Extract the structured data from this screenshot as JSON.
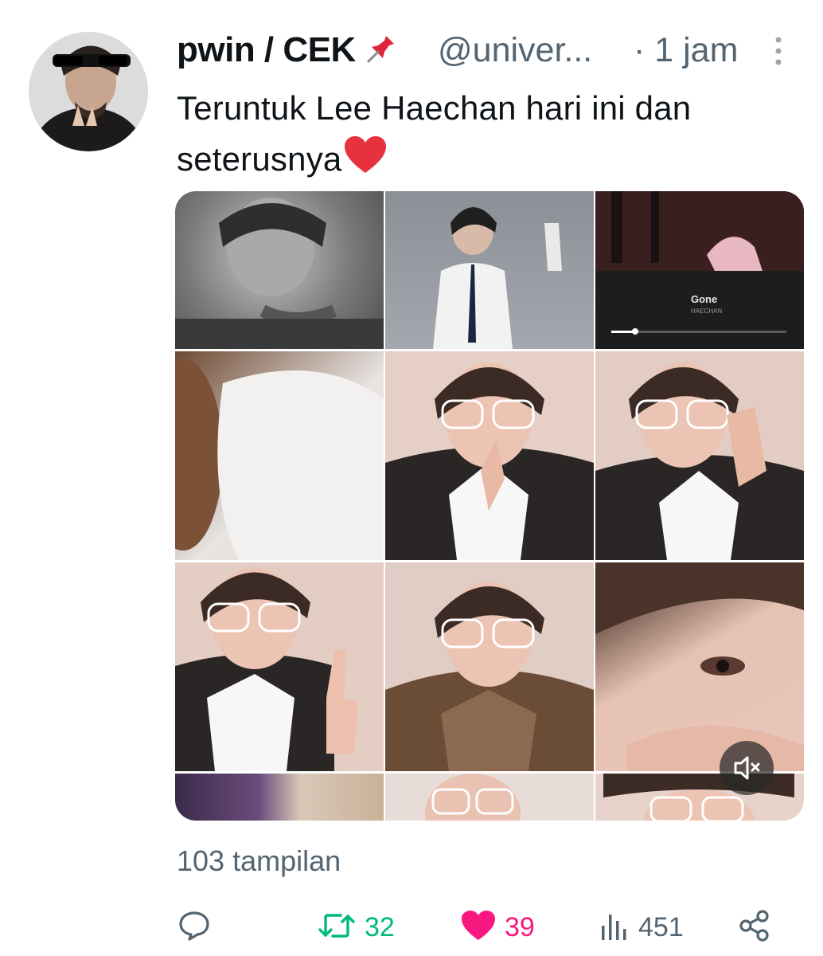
{
  "tweet": {
    "author": {
      "display_name": "pwin / CEK",
      "badge_emoji": "pushpin",
      "handle": "@univer...",
      "time": "· 1 jam",
      "avatar_icon": "avatar-photo"
    },
    "text_line1": "Teruntuk Lee Haechan hari ini dan",
    "text_line2": "seterusnya",
    "text_emoji": "red-heart",
    "media": {
      "type": "video",
      "player_title": "Gone",
      "player_artist": "HAECHAN",
      "mute_icon": "volume-muted-icon"
    },
    "views_text": "103 tampilan",
    "actions": {
      "reply_icon": "reply-icon",
      "retweet_count": "32",
      "retweet_color": "#00ba7c",
      "like_count": "39",
      "like_color": "#f91880",
      "analytics_count": "451",
      "share_icon": "share-icon"
    }
  }
}
